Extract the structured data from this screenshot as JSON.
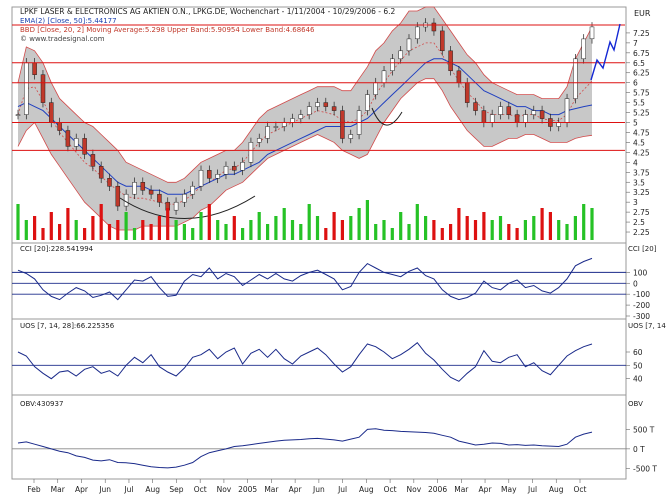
{
  "header": {
    "title": "LPKF LASER & ELECTRONICS AG AKTIEN O.N., LPKG.DE, Wochenchart - 1/11/2004 - 10/29/2006 - 6.2",
    "ema": "EMA(2) [Close, 50]:5.44177",
    "bbd": "BBD [Close, 20, 2] Moving Average:5.298 Upper Band:5.90954 Lower Band:4.68646",
    "source": "© www.tradesignal.com"
  },
  "currency": "EUR",
  "chart_data": [
    {
      "type": "line",
      "title": "LPKF LASER & ELECTRONICS AG AKTIEN O.N., LPKG.DE, Wochenchart - 1/11/2004 - 10/29/2006 - 6.2",
      "series": [
        {
          "name": "LPKG.DE (Close)",
          "x": [
            0,
            2,
            5,
            8,
            11,
            13,
            15,
            17,
            18,
            20,
            22,
            24,
            26,
            28,
            30,
            33,
            36,
            38,
            40,
            42,
            44,
            46,
            48,
            50,
            52,
            54,
            56,
            58,
            60,
            62,
            64,
            66,
            68,
            70,
            72,
            74,
            76,
            78,
            80,
            82,
            84,
            86,
            88,
            90,
            92,
            94,
            96,
            98,
            100,
            102,
            104,
            106,
            108,
            110,
            112,
            114,
            116,
            118,
            120,
            122,
            124,
            126,
            128,
            130,
            132,
            134,
            136,
            138,
            140,
            142
          ],
          "values": [
            5.2,
            6.5,
            6.2,
            5.5,
            5.0,
            4.8,
            4.4,
            4.6,
            4.2,
            3.9,
            3.6,
            3.4,
            2.9,
            3.2,
            3.5,
            3.3,
            3.2,
            3.0,
            2.8,
            3.0,
            3.2,
            3.4,
            3.8,
            3.6,
            3.7,
            3.9,
            3.8,
            4.0,
            4.5,
            4.6,
            4.9,
            4.9,
            5.0,
            5.1,
            5.2,
            5.4,
            5.5,
            5.4,
            5.3,
            4.6,
            4.7,
            5.3,
            5.7,
            6.0,
            6.3,
            6.6,
            6.8,
            7.1,
            7.4,
            7.5,
            7.3,
            6.8,
            6.3,
            6.0,
            5.5,
            5.3,
            5.0,
            5.2,
            5.4,
            5.2,
            5.0,
            5.2,
            5.3,
            5.1,
            4.9,
            5.0,
            5.6,
            6.6,
            7.1,
            7.4
          ]
        },
        {
          "name": "EMA [Close, 50]",
          "values": [
            5.4,
            5.5,
            5.4,
            5.3,
            5.1,
            4.9,
            4.7,
            4.5,
            4.3,
            4.1,
            3.9,
            3.7,
            3.5,
            3.4,
            3.4,
            3.4,
            3.3,
            3.3,
            3.2,
            3.2,
            3.2,
            3.3,
            3.4,
            3.5,
            3.6,
            3.7,
            3.7,
            3.8,
            3.9,
            4.0,
            4.2,
            4.3,
            4.4,
            4.5,
            4.6,
            4.7,
            4.8,
            4.9,
            4.9,
            4.9,
            4.9,
            5.0,
            5.1,
            5.3,
            5.5,
            5.7,
            5.9,
            6.1,
            6.3,
            6.5,
            6.6,
            6.6,
            6.5,
            6.4,
            6.2,
            6.0,
            5.8,
            5.7,
            5.6,
            5.5,
            5.4,
            5.4,
            5.3,
            5.3,
            5.2,
            5.2,
            5.3,
            5.35,
            5.4,
            5.44
          ]
        },
        {
          "name": "Upper Band",
          "values": [
            6.0,
            6.9,
            6.8,
            6.5,
            6.0,
            5.6,
            5.4,
            5.2,
            5.0,
            4.9,
            4.7,
            4.5,
            4.3,
            4.0,
            3.9,
            3.8,
            3.7,
            3.6,
            3.5,
            3.5,
            3.6,
            3.8,
            4.0,
            4.1,
            4.2,
            4.3,
            4.3,
            4.5,
            4.8,
            5.1,
            5.3,
            5.4,
            5.5,
            5.6,
            5.7,
            5.8,
            5.9,
            5.9,
            5.9,
            5.8,
            5.8,
            6.1,
            6.4,
            6.8,
            7.0,
            7.3,
            7.5,
            7.8,
            7.8,
            7.9,
            7.9,
            7.6,
            7.3,
            7.0,
            6.7,
            6.5,
            6.2,
            6.0,
            5.9,
            5.8,
            5.7,
            5.7,
            5.7,
            5.6,
            5.6,
            5.6,
            5.9,
            6.6,
            7.0,
            7.4
          ]
        },
        {
          "name": "Lower Band",
          "values": [
            4.4,
            4.8,
            5.0,
            4.6,
            4.2,
            3.9,
            3.6,
            3.3,
            3.0,
            2.8,
            2.6,
            2.4,
            2.3,
            2.3,
            2.3,
            2.4,
            2.4,
            2.4,
            2.4,
            2.4,
            2.5,
            2.6,
            2.8,
            2.9,
            3.1,
            3.3,
            3.4,
            3.5,
            3.7,
            3.9,
            4.1,
            4.2,
            4.3,
            4.4,
            4.5,
            4.6,
            4.7,
            4.6,
            4.5,
            4.3,
            4.2,
            4.1,
            4.2,
            4.6,
            5.0,
            5.3,
            5.6,
            5.8,
            6.0,
            6.1,
            6.1,
            5.8,
            5.4,
            5.1,
            4.8,
            4.6,
            4.4,
            4.4,
            4.5,
            4.6,
            4.6,
            4.7,
            4.7,
            4.6,
            4.5,
            4.5,
            4.5,
            4.6,
            4.65,
            4.68
          ]
        }
      ],
      "y_ticks": [
        "7.25",
        "6.75",
        "6.25",
        "5.75",
        "5.25",
        "4.75",
        "4.25",
        "3.75",
        "3.25",
        "2.75",
        "2.25",
        "7",
        "6.5",
        "6",
        "5.5",
        "5",
        "4.5",
        "4",
        "3.5",
        "3",
        "2.5"
      ],
      "ylim": [
        2.1,
        7.7
      ],
      "x_tick_labels": [
        "Feb",
        "Mar",
        "Apr",
        "Jun",
        "Jul",
        "Aug",
        "Sep",
        "Oct",
        "Nov",
        "2005",
        "Mar",
        "Apr",
        "Jun",
        "Jul",
        "Aug",
        "Oct",
        "Nov",
        "2006",
        "Mar",
        "Apr",
        "May",
        "Jul",
        "Aug",
        "Oct"
      ],
      "horizontal_lines": [
        7.45,
        6.5,
        6.0,
        5.0,
        4.3
      ],
      "projection_note": "blue forecast zigzag to about 7.4"
    },
    {
      "type": "bar",
      "name": "Volume",
      "values": [
        0.9,
        0.5,
        0.6,
        0.3,
        0.7,
        0.4,
        0.8,
        0.5,
        0.3,
        0.6,
        0.9,
        0.4,
        0.5,
        0.7,
        0.3,
        0.5,
        0.4,
        0.6,
        0.8,
        0.5,
        0.4,
        0.3,
        0.7,
        0.9,
        0.5,
        0.4,
        0.6,
        0.3,
        0.5,
        0.7,
        0.4,
        0.6,
        0.8,
        0.5,
        0.4,
        0.9,
        0.6,
        0.3,
        0.7,
        0.5,
        0.6,
        0.8,
        1.0,
        0.4,
        0.5,
        0.3,
        0.7,
        0.4,
        0.9,
        0.6,
        0.5,
        0.3,
        0.4,
        0.8,
        0.6,
        0.5,
        0.7,
        0.5,
        0.6,
        0.4,
        0.3,
        0.5,
        0.6,
        0.8,
        0.7,
        0.5,
        0.4,
        0.6,
        0.9,
        0.8
      ]
    },
    {
      "type": "line",
      "name": "CCI [20]",
      "legend": "CCI [20]:228.541994",
      "y_ticks": [
        "100",
        "0",
        "-100",
        "-200",
        "-300"
      ],
      "ylim": [
        -300,
        250
      ],
      "reference_lines": [
        100,
        0,
        -100
      ],
      "values": [
        120,
        90,
        40,
        -60,
        -120,
        -150,
        -90,
        -40,
        -70,
        -130,
        -110,
        -80,
        -150,
        -60,
        30,
        20,
        60,
        -40,
        -120,
        -110,
        20,
        80,
        60,
        140,
        40,
        90,
        60,
        -20,
        30,
        80,
        40,
        90,
        40,
        20,
        70,
        100,
        120,
        80,
        40,
        -60,
        -30,
        100,
        180,
        140,
        100,
        80,
        60,
        110,
        140,
        70,
        40,
        -60,
        -120,
        -150,
        -130,
        -90,
        20,
        -40,
        -60,
        0,
        30,
        -40,
        -20,
        -70,
        -90,
        -40,
        40,
        160,
        200,
        228
      ]
    },
    {
      "type": "line",
      "name": "UOS [7, 14, 28]",
      "legend": "UOS [7, 14, 28]:66.225356",
      "y_ticks": [
        "60",
        "50",
        "40"
      ],
      "ylim": [
        30,
        75
      ],
      "reference_lines": [
        50
      ],
      "values": [
        60,
        57,
        49,
        44,
        40,
        45,
        46,
        42,
        47,
        49,
        44,
        46,
        42,
        50,
        56,
        52,
        58,
        49,
        45,
        42,
        48,
        56,
        58,
        62,
        55,
        60,
        63,
        51,
        59,
        62,
        56,
        62,
        55,
        51,
        57,
        60,
        63,
        58,
        51,
        45,
        49,
        58,
        66,
        64,
        60,
        55,
        58,
        62,
        67,
        59,
        54,
        47,
        41,
        38,
        44,
        49,
        61,
        53,
        52,
        56,
        58,
        49,
        52,
        46,
        43,
        50,
        57,
        61,
        64,
        66
      ]
    },
    {
      "type": "line",
      "name": "OBV",
      "legend": "OBV:430937",
      "y_ticks": [
        "500 T",
        "0 T",
        "-500 T"
      ],
      "ylim": [
        -750000,
        1000000
      ],
      "reference_lines": [
        0
      ],
      "values": [
        150000,
        180000,
        120000,
        60000,
        0,
        -60000,
        -100000,
        -180000,
        -220000,
        -290000,
        -310000,
        -280000,
        -350000,
        -360000,
        -380000,
        -420000,
        -460000,
        -480000,
        -490000,
        -470000,
        -420000,
        -350000,
        -200000,
        -100000,
        -50000,
        0,
        60000,
        80000,
        110000,
        140000,
        170000,
        200000,
        220000,
        230000,
        240000,
        260000,
        270000,
        250000,
        230000,
        200000,
        250000,
        300000,
        500000,
        520000,
        480000,
        470000,
        450000,
        440000,
        430000,
        420000,
        400000,
        350000,
        300000,
        200000,
        150000,
        100000,
        120000,
        150000,
        140000,
        100000,
        110000,
        90000,
        100000,
        80000,
        70000,
        60000,
        120000,
        300000,
        380000,
        430937
      ]
    }
  ]
}
